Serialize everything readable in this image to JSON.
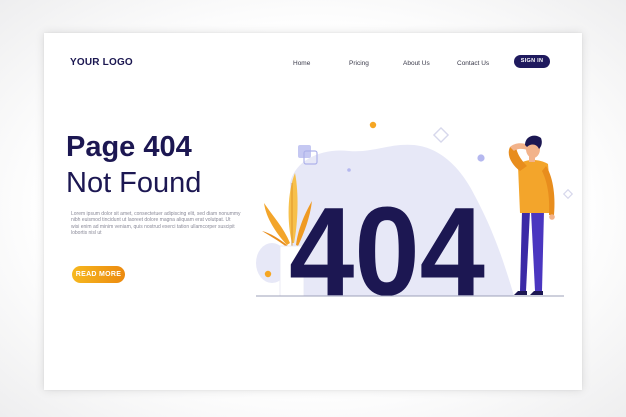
{
  "brand": {
    "logo_text": "YOUR LOGO",
    "primary_color": "#1c1752",
    "accent_color": "#f5a623"
  },
  "nav": {
    "items": [
      {
        "label": "Home"
      },
      {
        "label": "Pricing"
      },
      {
        "label": "About Us"
      },
      {
        "label": "Contact Us"
      }
    ],
    "signin_label": "SIGN IN"
  },
  "hero": {
    "title_line1": "Page 404",
    "title_line2": "Not Found",
    "description_lines": [
      "Lorem ipsum dolor sit amet, consectetuer adipiscing elit, sed diam nonummy",
      "nibh euismod tincidunt ut laoreet dolore magna aliquam erat volutpat. Ut",
      "wisi enim ad minim veniam, quis nostrud exerci tation ullamcorper suscipit",
      "lobortis nisl ut"
    ],
    "cta_label": "READ MORE"
  },
  "illustration": {
    "big_text": "404"
  }
}
